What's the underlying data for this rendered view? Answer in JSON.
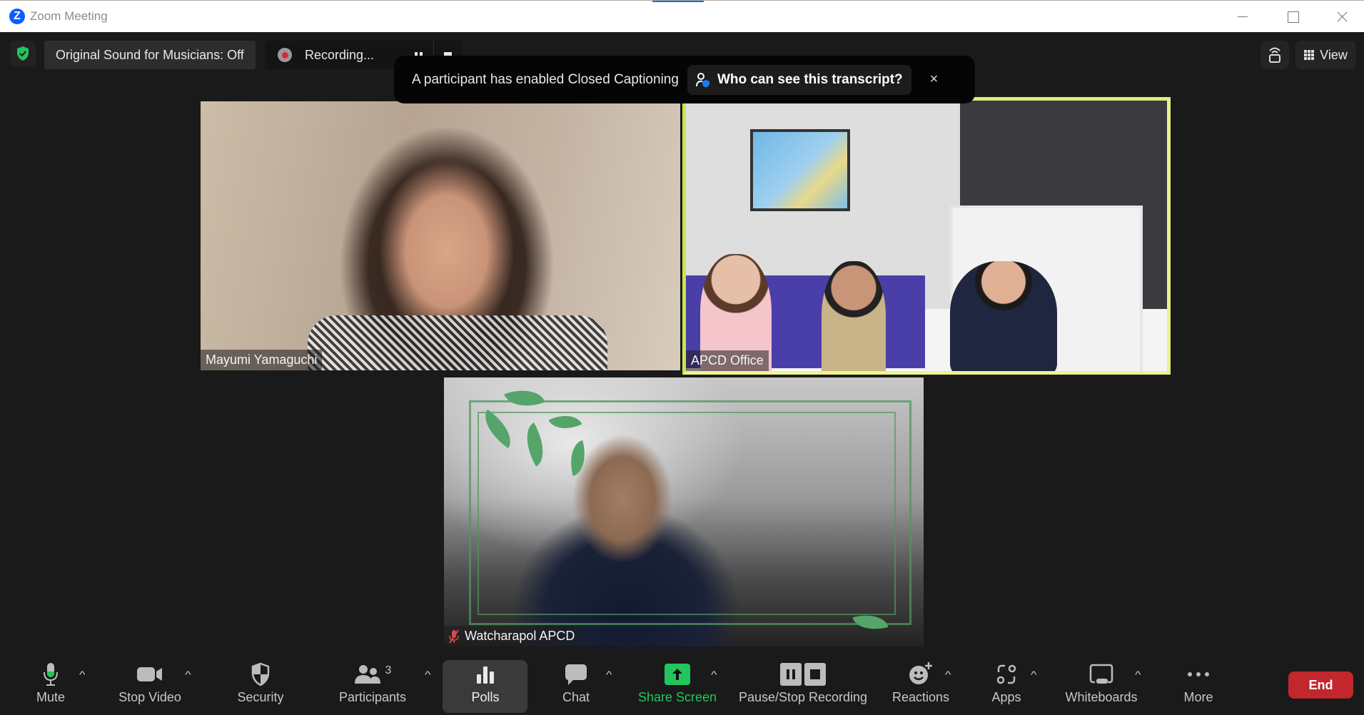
{
  "window": {
    "title": "Zoom Meeting",
    "logo_letter": "Z"
  },
  "status_bar": {
    "encryption_icon": "green-shield-check-icon",
    "original_sound_label": "Original Sound for Musicians: Off",
    "recording_label": "Recording...",
    "view_label": "View"
  },
  "caption_banner": {
    "message": "A participant has enabled Closed Captioning",
    "link_label": "Who can see this transcript?",
    "close_glyph": "×"
  },
  "participants_tiles": [
    {
      "name": "Mayumi Yamaguchi",
      "muted": false,
      "active_speaker": false
    },
    {
      "name": "APCD Office",
      "muted": false,
      "active_speaker": true
    },
    {
      "name": "Watcharapol APCD",
      "muted": true,
      "active_speaker": false
    }
  ],
  "toolbar": {
    "mute_label": "Mute",
    "stop_video_label": "Stop Video",
    "security_label": "Security",
    "participants_label": "Participants",
    "participants_count": "3",
    "polls_label": "Polls",
    "chat_label": "Chat",
    "share_screen_label": "Share Screen",
    "recording_label": "Pause/Stop Recording",
    "reactions_label": "Reactions",
    "apps_label": "Apps",
    "whiteboards_label": "Whiteboards",
    "more_label": "More",
    "end_label": "End",
    "caret_glyph": "^"
  },
  "colors": {
    "active_speaker_border": "#d6f05a",
    "share_green": "#22c55e",
    "end_red": "#c1272d",
    "mic_level_green": "#22c55e"
  }
}
